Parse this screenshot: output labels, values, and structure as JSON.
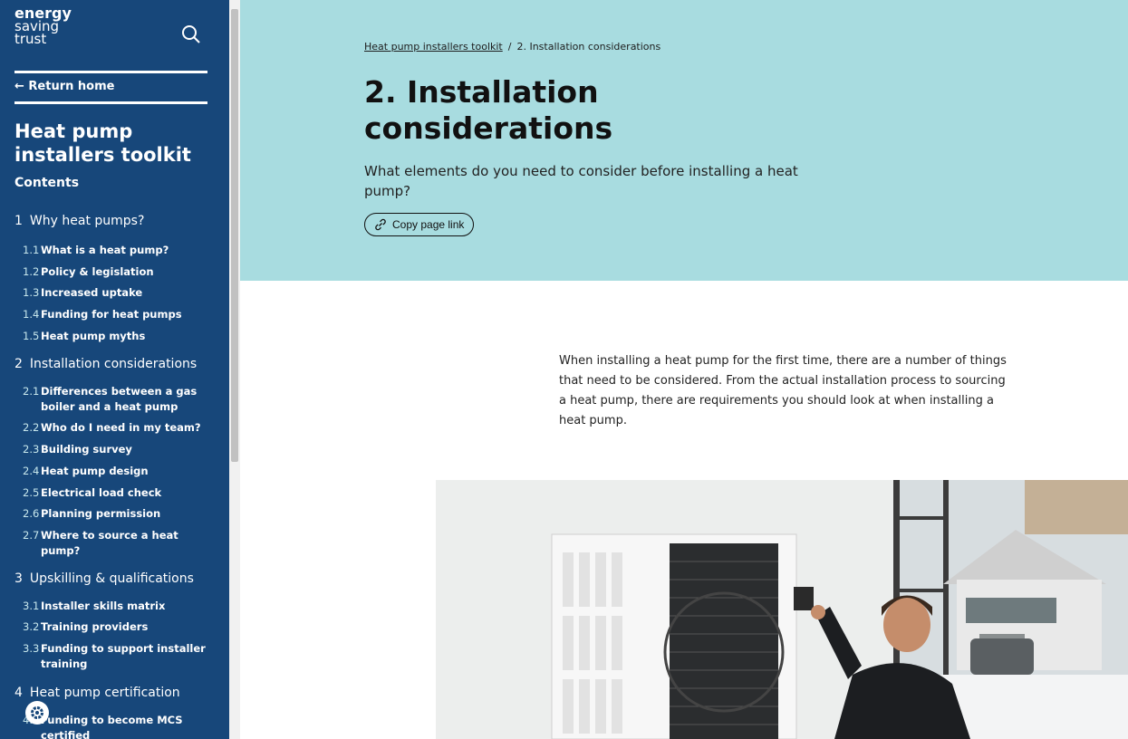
{
  "brand": {
    "line1": "energy",
    "line2": "saving",
    "line3": "trust"
  },
  "sidebar": {
    "return_label": "← Return home",
    "toolkit_title": "Heat pump installers toolkit",
    "contents_label": "Contents",
    "sections": [
      {
        "num": "1",
        "label": "Why heat pumps?",
        "items": [
          {
            "num": "1.1",
            "label": "What is a heat pump?"
          },
          {
            "num": "1.2",
            "label": "Policy & legislation"
          },
          {
            "num": "1.3",
            "label": "Increased uptake"
          },
          {
            "num": "1.4",
            "label": "Funding for heat pumps"
          },
          {
            "num": "1.5",
            "label": "Heat pump myths"
          }
        ]
      },
      {
        "num": "2",
        "label": "Installation considerations",
        "items": [
          {
            "num": "2.1",
            "label": "Differences between a gas boiler and a heat pump"
          },
          {
            "num": "2.2",
            "label": "Who do I need in my team?"
          },
          {
            "num": "2.3",
            "label": "Building survey"
          },
          {
            "num": "2.4",
            "label": "Heat pump design"
          },
          {
            "num": "2.5",
            "label": "Electrical load check"
          },
          {
            "num": "2.6",
            "label": "Planning permission"
          },
          {
            "num": "2.7",
            "label": "Where to source a heat pump?"
          }
        ]
      },
      {
        "num": "3",
        "label": "Upskilling & qualifications",
        "items": [
          {
            "num": "3.1",
            "label": "Installer skills matrix"
          },
          {
            "num": "3.2",
            "label": "Training providers"
          },
          {
            "num": "3.3",
            "label": "Funding to support installer training"
          }
        ]
      },
      {
        "num": "4",
        "label": "Heat pump certification",
        "items": [
          {
            "num": "4.1",
            "label": "Funding to become MCS certified"
          }
        ]
      }
    ]
  },
  "breadcrumb": {
    "link": "Heat pump installers toolkit",
    "separator": "/",
    "current": "2. Installation considerations"
  },
  "hero": {
    "title": "2. Installation considerations",
    "subtitle": "What elements do you need to consider before installing a heat pump?",
    "copy_link_label": "Copy page link"
  },
  "intro": "When installing a heat pump for the first time, there are a number of things that need to be considered. From the actual installation process to sourcing a heat pump, there are requirements you should look at when installing a heat pump.",
  "colors": {
    "sidebar": "#17477a",
    "hero": "#a8dce0",
    "accent": "#c7e7ec"
  },
  "icons": {
    "search": "search-icon",
    "link": "link-icon",
    "settings": "gear-icon"
  }
}
